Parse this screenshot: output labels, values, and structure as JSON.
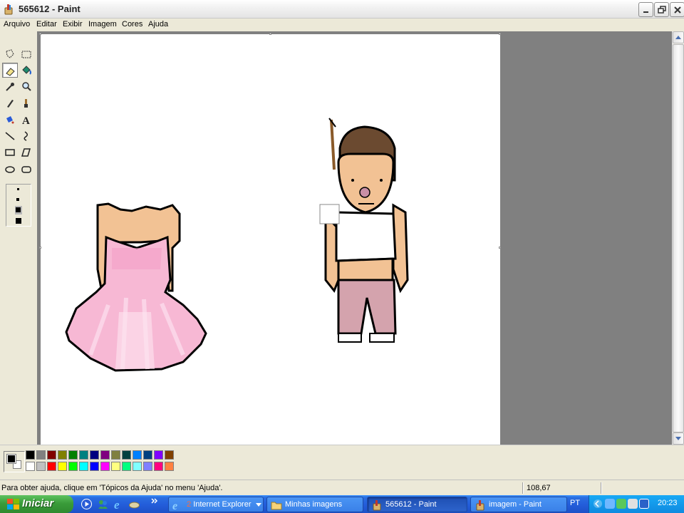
{
  "window": {
    "title": "565612 - Paint"
  },
  "menu": {
    "items": [
      "Arquivo",
      "Editar",
      "Exibir",
      "Imagem",
      "Cores",
      "Ajuda"
    ]
  },
  "toolbox": {
    "tools": [
      "free-select",
      "rect-select",
      "eraser",
      "fill",
      "color-picker",
      "magnifier",
      "pencil",
      "brush",
      "airbrush",
      "text",
      "line",
      "curve",
      "rectangle",
      "polygon",
      "ellipse",
      "rounded-rectangle"
    ],
    "selected_tool": "eraser"
  },
  "palette": {
    "foreground": "#000000",
    "background": "#ffffff",
    "colors_top": [
      "#000000",
      "#808080",
      "#800000",
      "#808000",
      "#008000",
      "#008080",
      "#000080",
      "#800080",
      "#808040",
      "#004040",
      "#0080ff",
      "#004080",
      "#8000ff",
      "#804000"
    ],
    "colors_bottom": [
      "#ffffff",
      "#c0c0c0",
      "#ff0000",
      "#ffff00",
      "#00ff00",
      "#00ffff",
      "#0000ff",
      "#ff00ff",
      "#ffff80",
      "#00ff80",
      "#80ffff",
      "#8080ff",
      "#ff0080",
      "#ff8040"
    ]
  },
  "status": {
    "help": "Para obter ajuda, clique em 'Tópicos da Ajuda' no menu 'Ajuda'.",
    "coords": "108,67"
  },
  "taskbar": {
    "start_label": "Iniciar",
    "tasks": [
      {
        "label": "Internet Explorer",
        "badge": "2",
        "active": false
      },
      {
        "label": "Minhas imagens",
        "active": false
      },
      {
        "label": "565612 - Paint",
        "active": true
      },
      {
        "label": "imagem - Paint",
        "active": false
      }
    ],
    "language": "PT",
    "clock": "20:23"
  }
}
